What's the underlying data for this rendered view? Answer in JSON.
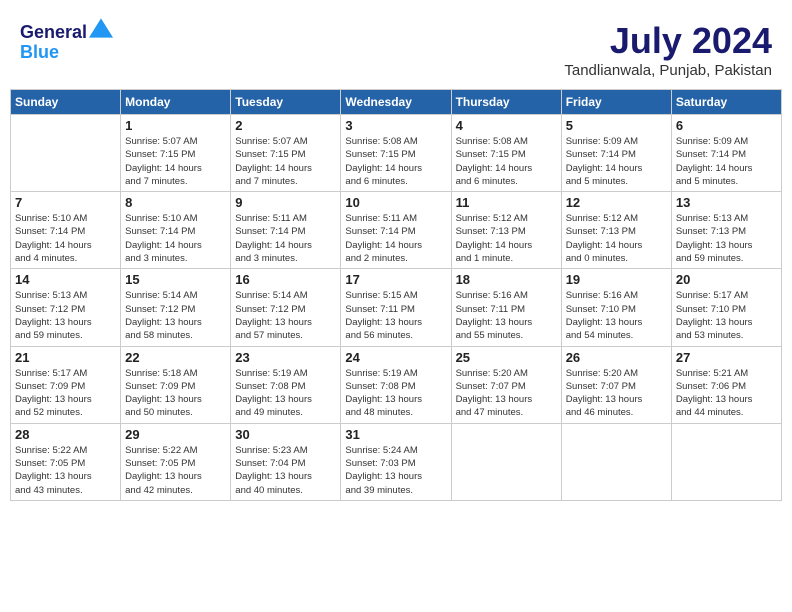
{
  "header": {
    "logo_line1": "General",
    "logo_line2": "Blue",
    "title": "July 2024",
    "location": "Tandlianwala, Punjab, Pakistan"
  },
  "weekdays": [
    "Sunday",
    "Monday",
    "Tuesday",
    "Wednesday",
    "Thursday",
    "Friday",
    "Saturday"
  ],
  "weeks": [
    [
      {
        "day": "",
        "info": ""
      },
      {
        "day": "1",
        "info": "Sunrise: 5:07 AM\nSunset: 7:15 PM\nDaylight: 14 hours\nand 7 minutes."
      },
      {
        "day": "2",
        "info": "Sunrise: 5:07 AM\nSunset: 7:15 PM\nDaylight: 14 hours\nand 7 minutes."
      },
      {
        "day": "3",
        "info": "Sunrise: 5:08 AM\nSunset: 7:15 PM\nDaylight: 14 hours\nand 6 minutes."
      },
      {
        "day": "4",
        "info": "Sunrise: 5:08 AM\nSunset: 7:15 PM\nDaylight: 14 hours\nand 6 minutes."
      },
      {
        "day": "5",
        "info": "Sunrise: 5:09 AM\nSunset: 7:14 PM\nDaylight: 14 hours\nand 5 minutes."
      },
      {
        "day": "6",
        "info": "Sunrise: 5:09 AM\nSunset: 7:14 PM\nDaylight: 14 hours\nand 5 minutes."
      }
    ],
    [
      {
        "day": "7",
        "info": "Sunrise: 5:10 AM\nSunset: 7:14 PM\nDaylight: 14 hours\nand 4 minutes."
      },
      {
        "day": "8",
        "info": "Sunrise: 5:10 AM\nSunset: 7:14 PM\nDaylight: 14 hours\nand 3 minutes."
      },
      {
        "day": "9",
        "info": "Sunrise: 5:11 AM\nSunset: 7:14 PM\nDaylight: 14 hours\nand 3 minutes."
      },
      {
        "day": "10",
        "info": "Sunrise: 5:11 AM\nSunset: 7:14 PM\nDaylight: 14 hours\nand 2 minutes."
      },
      {
        "day": "11",
        "info": "Sunrise: 5:12 AM\nSunset: 7:13 PM\nDaylight: 14 hours\nand 1 minute."
      },
      {
        "day": "12",
        "info": "Sunrise: 5:12 AM\nSunset: 7:13 PM\nDaylight: 14 hours\nand 0 minutes."
      },
      {
        "day": "13",
        "info": "Sunrise: 5:13 AM\nSunset: 7:13 PM\nDaylight: 13 hours\nand 59 minutes."
      }
    ],
    [
      {
        "day": "14",
        "info": "Sunrise: 5:13 AM\nSunset: 7:12 PM\nDaylight: 13 hours\nand 59 minutes."
      },
      {
        "day": "15",
        "info": "Sunrise: 5:14 AM\nSunset: 7:12 PM\nDaylight: 13 hours\nand 58 minutes."
      },
      {
        "day": "16",
        "info": "Sunrise: 5:14 AM\nSunset: 7:12 PM\nDaylight: 13 hours\nand 57 minutes."
      },
      {
        "day": "17",
        "info": "Sunrise: 5:15 AM\nSunset: 7:11 PM\nDaylight: 13 hours\nand 56 minutes."
      },
      {
        "day": "18",
        "info": "Sunrise: 5:16 AM\nSunset: 7:11 PM\nDaylight: 13 hours\nand 55 minutes."
      },
      {
        "day": "19",
        "info": "Sunrise: 5:16 AM\nSunset: 7:10 PM\nDaylight: 13 hours\nand 54 minutes."
      },
      {
        "day": "20",
        "info": "Sunrise: 5:17 AM\nSunset: 7:10 PM\nDaylight: 13 hours\nand 53 minutes."
      }
    ],
    [
      {
        "day": "21",
        "info": "Sunrise: 5:17 AM\nSunset: 7:09 PM\nDaylight: 13 hours\nand 52 minutes."
      },
      {
        "day": "22",
        "info": "Sunrise: 5:18 AM\nSunset: 7:09 PM\nDaylight: 13 hours\nand 50 minutes."
      },
      {
        "day": "23",
        "info": "Sunrise: 5:19 AM\nSunset: 7:08 PM\nDaylight: 13 hours\nand 49 minutes."
      },
      {
        "day": "24",
        "info": "Sunrise: 5:19 AM\nSunset: 7:08 PM\nDaylight: 13 hours\nand 48 minutes."
      },
      {
        "day": "25",
        "info": "Sunrise: 5:20 AM\nSunset: 7:07 PM\nDaylight: 13 hours\nand 47 minutes."
      },
      {
        "day": "26",
        "info": "Sunrise: 5:20 AM\nSunset: 7:07 PM\nDaylight: 13 hours\nand 46 minutes."
      },
      {
        "day": "27",
        "info": "Sunrise: 5:21 AM\nSunset: 7:06 PM\nDaylight: 13 hours\nand 44 minutes."
      }
    ],
    [
      {
        "day": "28",
        "info": "Sunrise: 5:22 AM\nSunset: 7:05 PM\nDaylight: 13 hours\nand 43 minutes."
      },
      {
        "day": "29",
        "info": "Sunrise: 5:22 AM\nSunset: 7:05 PM\nDaylight: 13 hours\nand 42 minutes."
      },
      {
        "day": "30",
        "info": "Sunrise: 5:23 AM\nSunset: 7:04 PM\nDaylight: 13 hours\nand 40 minutes."
      },
      {
        "day": "31",
        "info": "Sunrise: 5:24 AM\nSunset: 7:03 PM\nDaylight: 13 hours\nand 39 minutes."
      },
      {
        "day": "",
        "info": ""
      },
      {
        "day": "",
        "info": ""
      },
      {
        "day": "",
        "info": ""
      }
    ]
  ]
}
